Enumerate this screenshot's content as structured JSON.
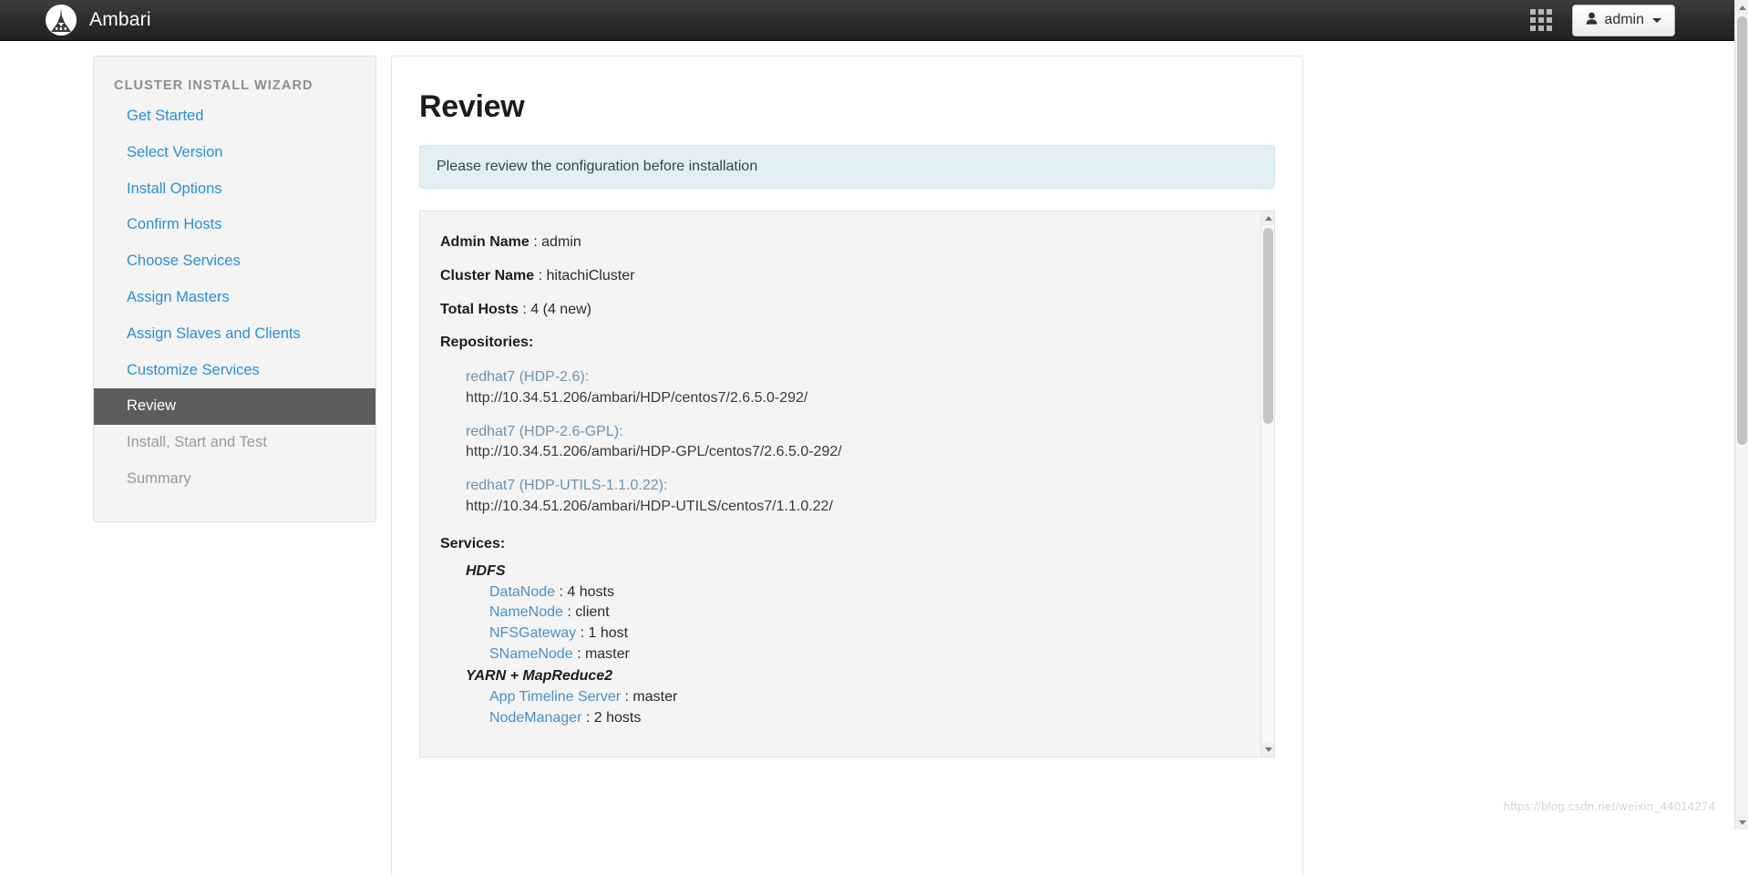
{
  "navbar": {
    "brand": "Ambari",
    "logo_icon": "ambari-mountain-logo",
    "grid_icon": "apps-grid-icon",
    "user_icon": "user-icon",
    "admin_label": "admin",
    "caret_icon": "caret-down-icon"
  },
  "sidebar": {
    "title": "CLUSTER INSTALL WIZARD",
    "items": [
      {
        "label": "Get Started",
        "state": "link"
      },
      {
        "label": "Select Version",
        "state": "link"
      },
      {
        "label": "Install Options",
        "state": "link"
      },
      {
        "label": "Confirm Hosts",
        "state": "link"
      },
      {
        "label": "Choose Services",
        "state": "link"
      },
      {
        "label": "Assign Masters",
        "state": "link"
      },
      {
        "label": "Assign Slaves and Clients",
        "state": "link"
      },
      {
        "label": "Customize Services",
        "state": "link"
      },
      {
        "label": "Review",
        "state": "active"
      },
      {
        "label": "Install, Start and Test",
        "state": "disabled"
      },
      {
        "label": "Summary",
        "state": "disabled"
      }
    ]
  },
  "main": {
    "title": "Review",
    "alert": "Please review the configuration before installation",
    "summary": [
      {
        "label": "Admin Name",
        "value": "admin"
      },
      {
        "label": "Cluster Name",
        "value": "hitachiCluster"
      },
      {
        "label": "Total Hosts",
        "value": "4 (4 new)"
      }
    ],
    "repositories_label": "Repositories:",
    "repositories": [
      {
        "name": "redhat7 (HDP-2.6):",
        "url": "http://10.34.51.206/ambari/HDP/centos7/2.6.5.0-292/"
      },
      {
        "name": "redhat7 (HDP-2.6-GPL):",
        "url": "http://10.34.51.206/ambari/HDP-GPL/centos7/2.6.5.0-292/"
      },
      {
        "name": "redhat7 (HDP-UTILS-1.1.0.22):",
        "url": "http://10.34.51.206/ambari/HDP-UTILS/centos7/1.1.0.22/"
      }
    ],
    "services_label": "Services:",
    "services": [
      {
        "name": "HDFS",
        "components": [
          {
            "component": "DataNode",
            "value": ": 4 hosts"
          },
          {
            "component": "NameNode",
            "value": ": client"
          },
          {
            "component": "NFSGateway",
            "value": ": 1 host"
          },
          {
            "component": "SNameNode",
            "value": ": master"
          }
        ]
      },
      {
        "name": "YARN + MapReduce2",
        "components": [
          {
            "component": "App Timeline Server",
            "value": ": master"
          },
          {
            "component": "NodeManager",
            "value": ": 2 hosts"
          }
        ]
      }
    ]
  },
  "watermark": "https://blog.csdn.net/weixin_44014274",
  "colors": {
    "link": "#2a8fd4",
    "active_bg": "#5c5c5c",
    "alert_bg": "#e2eff5",
    "panel_bg": "#f4f4f4",
    "component_link": "#4a90c4",
    "repo_name": "#6d93ad"
  }
}
